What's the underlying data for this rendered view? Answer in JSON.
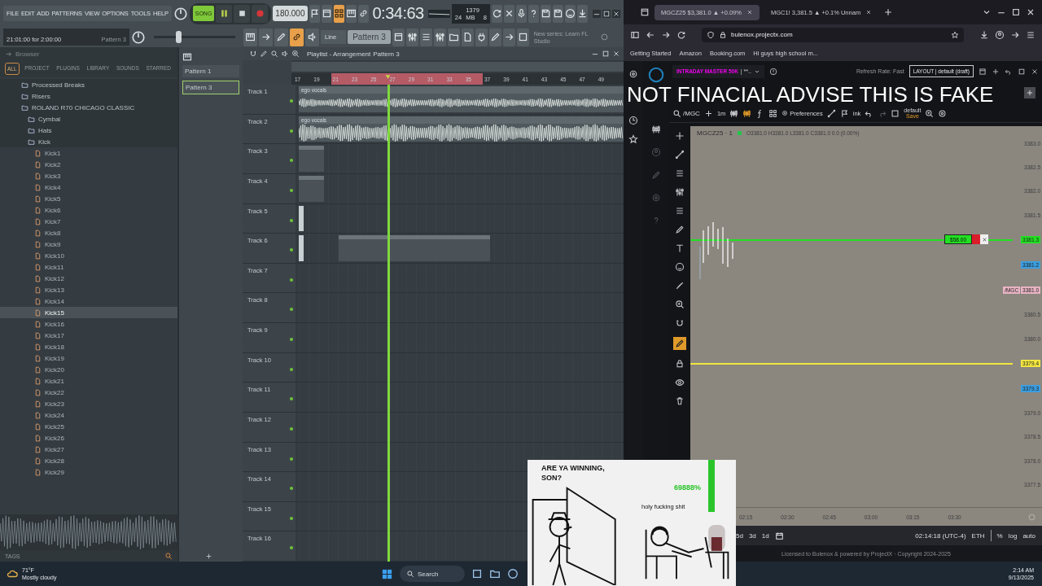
{
  "daw": {
    "menu": [
      "FILE",
      "EDIT",
      "ADD",
      "PATTERNS",
      "VIEW",
      "OPTIONS",
      "TOOLS",
      "HELP"
    ],
    "mode": {
      "label": "SONG",
      "selected": true
    },
    "transport": {
      "playing": true
    },
    "tempo": "180.000",
    "row1_tools": [
      {
        "on": false
      },
      {
        "on": false
      },
      {
        "on": true
      },
      {
        "on": false
      },
      {
        "on": false
      }
    ],
    "time": "0:34:63",
    "cpu": "24",
    "memory": "1379 MB",
    "polyphony": "8",
    "hint": "21:01:00 for 2:00:00",
    "hint_pattern": "Pattern 3",
    "master_slider": {
      "level": 0.3
    },
    "row2_tools": [
      {
        "on": false
      },
      {
        "on": false
      },
      {
        "on": false
      },
      {
        "on": true
      },
      {
        "on": false
      }
    ],
    "snap": "Line",
    "pattern": "Pattern 3",
    "news": "New series: Learn FL Studio"
  },
  "browser_panel": {
    "title": "Browser",
    "tabs": [
      {
        "label": "ALL",
        "selected": true
      },
      {
        "label": "PROJECT",
        "selected": false
      },
      {
        "label": "PLUGINS",
        "selected": false
      },
      {
        "label": "LIBRARY",
        "selected": false
      },
      {
        "label": "SOUNDS",
        "selected": false
      },
      {
        "label": "STARRED",
        "selected": false
      }
    ],
    "tree": [
      {
        "label": "Processed Breaks",
        "kind": "folder",
        "selected": false
      },
      {
        "label": "Risers",
        "kind": "folder",
        "selected": false
      },
      {
        "label": "ROLAND R70 CHICAGO CLASSIC",
        "kind": "folder",
        "selected": false,
        "children": [
          {
            "label": "Cymbal",
            "kind": "folder",
            "selected": false
          },
          {
            "label": "Hats",
            "kind": "folder",
            "selected": false
          },
          {
            "label": "Kick",
            "kind": "folder",
            "selected": false,
            "children": [
              {
                "label": "Kick1",
                "kind": "file",
                "selected": false
              },
              {
                "label": "Kick2",
                "kind": "file",
                "selected": false
              },
              {
                "label": "Kick3",
                "kind": "file",
                "selected": false
              },
              {
                "label": "Kick4",
                "kind": "file",
                "selected": false
              },
              {
                "label": "Kick5",
                "kind": "file",
                "selected": false
              },
              {
                "label": "Kick6",
                "kind": "file",
                "selected": false
              },
              {
                "label": "Kick7",
                "kind": "file",
                "selected": false
              },
              {
                "label": "Kick8",
                "kind": "file",
                "selected": false
              },
              {
                "label": "Kick9",
                "kind": "file",
                "selected": false
              },
              {
                "label": "Kick10",
                "kind": "file",
                "selected": false
              },
              {
                "label": "Kick11",
                "kind": "file",
                "selected": false
              },
              {
                "label": "Kick12",
                "kind": "file",
                "selected": false
              },
              {
                "label": "Kick13",
                "kind": "file",
                "selected": false
              },
              {
                "label": "Kick14",
                "kind": "file",
                "selected": false
              },
              {
                "label": "Kick15",
                "kind": "file",
                "selected": true
              },
              {
                "label": "Kick16",
                "kind": "file",
                "selected": false
              },
              {
                "label": "Kick17",
                "kind": "file",
                "selected": false
              },
              {
                "label": "Kick18",
                "kind": "file",
                "selected": false
              },
              {
                "label": "Kick19",
                "kind": "file",
                "selected": false
              },
              {
                "label": "Kick20",
                "kind": "file",
                "selected": false
              },
              {
                "label": "Kick21",
                "kind": "file",
                "selected": false
              },
              {
                "label": "Kick22",
                "kind": "file",
                "selected": false
              },
              {
                "label": "Kick23",
                "kind": "file",
                "selected": false
              },
              {
                "label": "Kick24",
                "kind": "file",
                "selected": false
              },
              {
                "label": "Kick25",
                "kind": "file",
                "selected": false
              },
              {
                "label": "Kick26",
                "kind": "file",
                "selected": false
              },
              {
                "label": "Kick27",
                "kind": "file",
                "selected": false
              },
              {
                "label": "Kick28",
                "kind": "file",
                "selected": false
              },
              {
                "label": "Kick29",
                "kind": "file",
                "selected": false
              }
            ]
          }
        ]
      }
    ],
    "footer": "TAGS"
  },
  "patterns": [
    {
      "label": "Pattern 1",
      "selected": false
    },
    {
      "label": "Pattern 3",
      "selected": true
    }
  ],
  "playlist": {
    "title": "Playlist - Arrangement",
    "crumb": "Pattern 3",
    "ruler": [
      "17",
      "19",
      "21",
      "23",
      "25",
      "27",
      "29",
      "31",
      "33",
      "35",
      "37",
      "39",
      "41",
      "43",
      "45",
      "47",
      "49"
    ],
    "tracks": [
      {
        "name": "Track 1",
        "clips": [
          {
            "kind": "audio",
            "label": "ego vocals"
          }
        ]
      },
      {
        "name": "Track 2",
        "clips": [
          {
            "kind": "audio",
            "label": "ego vocals"
          }
        ]
      },
      {
        "name": "Track 3",
        "clips": [
          {
            "kind": "pattern"
          }
        ]
      },
      {
        "name": "Track 4",
        "clips": [
          {
            "kind": "pattern"
          }
        ]
      },
      {
        "name": "Track 5",
        "clips": [
          {
            "kind": "automation"
          }
        ]
      },
      {
        "name": "Track 6",
        "clips": [
          {
            "kind": "automation"
          },
          {
            "kind": "rest"
          },
          {
            "kind": "pattern"
          },
          {
            "kind": "pattern"
          },
          {
            "kind": "pattern"
          },
          {
            "kind": "pattern"
          },
          {
            "kind": "pattern"
          },
          {
            "kind": "pattern"
          }
        ]
      },
      {
        "name": "Track 7"
      },
      {
        "name": "Track 8"
      },
      {
        "name": "Track 9"
      },
      {
        "name": "Track 10"
      },
      {
        "name": "Track 11"
      },
      {
        "name": "Track 12"
      },
      {
        "name": "Track 13"
      },
      {
        "name": "Track 14"
      },
      {
        "name": "Track 15"
      },
      {
        "name": "Track 16"
      }
    ]
  },
  "web": {
    "tabs": [
      {
        "label": "MGCZ25 $3,381.0 ▲ +0.09%",
        "selected": true
      },
      {
        "label": "MGC1! 3,381.5 ▲ +0.1% Unnam",
        "selected": false
      }
    ],
    "url": "bulenox.projectx.com",
    "bookmarks": [
      "Getting Started",
      "Amazon",
      "Booking.com",
      "Hi guys high school m..."
    ],
    "account": "INTRADAY MASTER 50K",
    "account_suffix": "| **..",
    "refresh": "Refresh Rate: Fast",
    "layout": "LAYOUT | default (draft)",
    "toolbar": {
      "symbol": "/MGC",
      "interval": "1m",
      "preferences": "Preferences",
      "link": "ink",
      "template": "default",
      "template_note": "Save"
    },
    "chart": {
      "symbol": "MGCZ25 · 1",
      "ohlc": "O3381.0 H3381.0 L3381.0 C3381.0 0.0 (0.00%)",
      "axis": [
        {
          "kind": "tick",
          "label": "3383.0"
        },
        {
          "kind": "tick",
          "label": "3382.5"
        },
        {
          "kind": "tick",
          "label": "3382.0"
        },
        {
          "kind": "tick",
          "label": "3381.5"
        },
        {
          "kind": "marker",
          "label": "3381.3",
          "color": "#22e022",
          "line": true
        },
        {
          "kind": "marker",
          "label": "3381.2",
          "color": "#3b9ee0"
        },
        {
          "kind": "marker",
          "label": "3381.0",
          "color": "#e8b4c4",
          "tag": "/MGC"
        },
        {
          "kind": "tick",
          "label": "3380.5"
        },
        {
          "kind": "tick",
          "label": "3380.0"
        },
        {
          "kind": "marker",
          "label": "3379.4",
          "color": "#f2e640",
          "line": true
        },
        {
          "kind": "marker",
          "label": "3379.3",
          "color": "#3b9ee0"
        },
        {
          "kind": "tick",
          "label": "3379.0"
        },
        {
          "kind": "tick",
          "label": "3378.5"
        },
        {
          "kind": "tick",
          "label": "3378.0"
        },
        {
          "kind": "tick",
          "label": "3377.5"
        }
      ],
      "position": {
        "pnl": "$58.00"
      },
      "times": [
        "02:15",
        "02:30",
        "02:45",
        "03:00",
        "03:15",
        "03:30"
      ],
      "ranges": [
        "5d",
        "3d",
        "1d"
      ],
      "clock": "02:14:18 (UTC-4)",
      "session": "ETH",
      "options": [
        "%",
        "log",
        "auto"
      ],
      "copyright": "Licensed to Bulenox & powered by ProjectX · Copyright 2024-2025"
    }
  },
  "taskbar": {
    "temp": "71°F",
    "condition": "Mostly cloudy",
    "search": {
      "placeholder": "Search"
    },
    "time": "2:14 AM",
    "date": "9/13/2025"
  },
  "overlay": {
    "caption": "NOT FINACIAL ADVISE THIS IS FAKE",
    "meme": {
      "question": "ARE YA WINNING, SON?",
      "percent": "69888%",
      "reaction": "holy fucking shit"
    }
  }
}
